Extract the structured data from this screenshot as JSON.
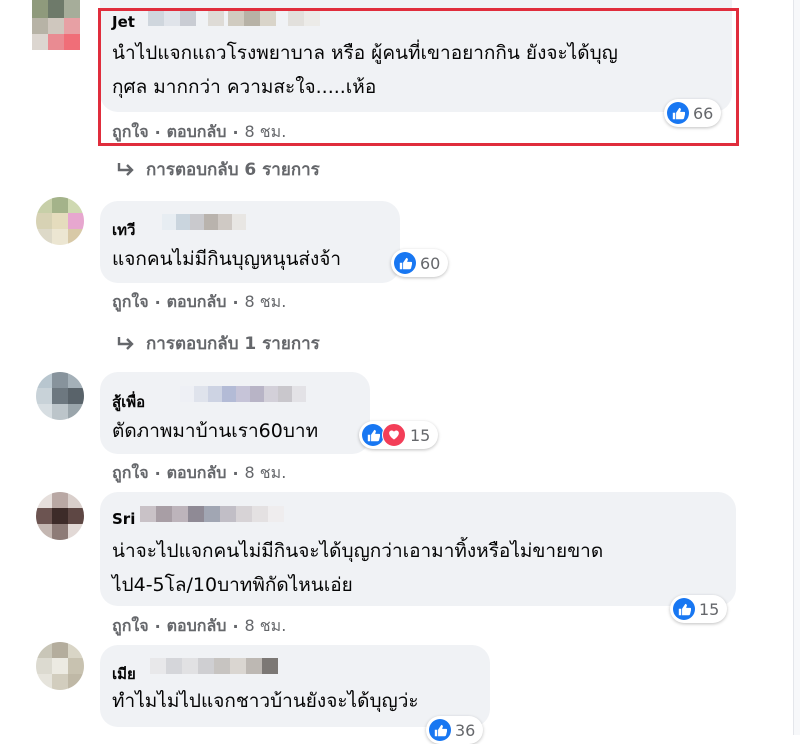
{
  "accent_like": "#1877f2",
  "accent_love": "#f33e58",
  "highlight_color": "#e02d3c",
  "comments": [
    {
      "author": "Jet",
      "text": "นำไปแจกแถวโรงพยาบาล หรือ ผู้คนที่เขาอยากกิน ยังจะได้บุญ\nกุศล มากกว่า ความสะใจ.....เห้อ",
      "like_label": "ถูกใจ",
      "reply_label": "ตอบกลับ",
      "time": "8 ชม.",
      "reactions": [
        "like-icon"
      ],
      "reaction_count": "66",
      "replies_link": "การตอบกลับ 6 รายการ"
    },
    {
      "author": "เทวี",
      "text": "แจกคนไม่มีกินบุญหนุนส่งจ้า",
      "like_label": "ถูกใจ",
      "reply_label": "ตอบกลับ",
      "time": "8 ชม.",
      "reactions": [
        "like-icon"
      ],
      "reaction_count": "60",
      "replies_link": "การตอบกลับ 1 รายการ"
    },
    {
      "author": "สู้เพื่อ",
      "text": "ตัดภาพมาบ้านเรา60บาท",
      "like_label": "ถูกใจ",
      "reply_label": "ตอบกลับ",
      "time": "8 ชม.",
      "reactions": [
        "like-icon",
        "love-icon"
      ],
      "reaction_count": "15"
    },
    {
      "author": "Sri",
      "text": "น่าจะไปแจกคนไม่มีกินจะได้บุญกว่าเอามาทิ้งหรือไม่ขายขาด\nไป4-5โล/10บาทพิกัดไหนเอ่ย",
      "like_label": "ถูกใจ",
      "reply_label": "ตอบกลับ",
      "time": "8 ชม.",
      "reactions": [
        "like-icon"
      ],
      "reaction_count": "15"
    },
    {
      "author": "เมีย",
      "text": "ทำไมไม่ไปแจกชาวบ้านยังจะได้บุญว่ะ",
      "reactions": [
        "like-icon"
      ],
      "reaction_count": "36"
    }
  ]
}
